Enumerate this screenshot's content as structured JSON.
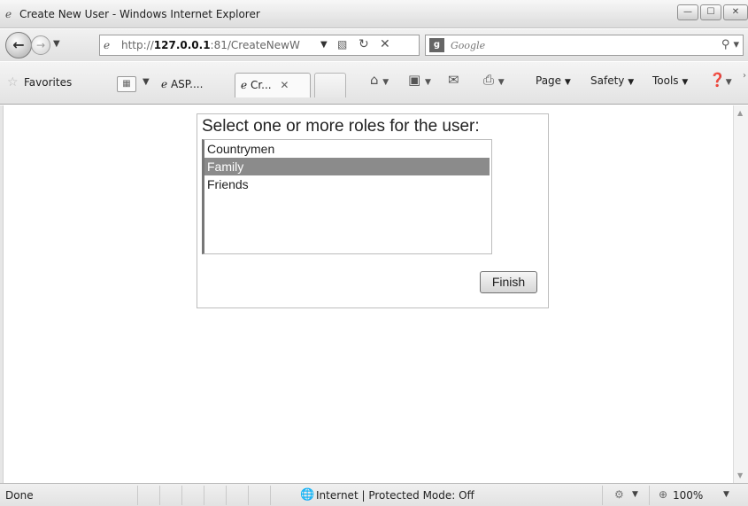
{
  "window": {
    "title": "Create New User - Windows Internet Explorer",
    "controls": {
      "minimize": "—",
      "maximize": "☐",
      "close": "✕"
    }
  },
  "address_bar": {
    "url_prefix": "http://",
    "url_host": "127.0.0.1",
    "url_rest": ":81/CreateNewW",
    "search_provider": "Google"
  },
  "favorites_bar": {
    "favorites_label": "Favorites",
    "tabs": [
      {
        "label": "ASP....",
        "active": false
      },
      {
        "label": "Cr...",
        "active": true
      }
    ],
    "commands": {
      "page": "Page",
      "safety": "Safety",
      "tools": "Tools"
    }
  },
  "content": {
    "prompt": "Select one or more roles for the user:",
    "roles": [
      {
        "label": "Countrymen",
        "selected": false
      },
      {
        "label": "Family",
        "selected": true
      },
      {
        "label": "Friends",
        "selected": false
      }
    ],
    "finish_label": "Finish"
  },
  "status_bar": {
    "status": "Done",
    "zone": "Internet | Protected Mode: Off",
    "zoom": "100%"
  },
  "icons": [
    "ie-logo-icon",
    "back-arrow-icon",
    "forward-arrow-icon",
    "page-icon",
    "compat-view-icon",
    "refresh-icon",
    "stop-icon",
    "google-logo-icon",
    "search-icon",
    "favorites-star-icon",
    "quick-tabs-icon",
    "home-icon",
    "feeds-icon",
    "mail-icon",
    "print-icon",
    "help-icon",
    "globe-icon",
    "protected-mode-icon",
    "zoom-icon"
  ],
  "colors": {
    "selected_row_bg": "#8b8b8b",
    "selected_row_text": "#ffffff",
    "chrome_bg": "#e6e6e6"
  }
}
